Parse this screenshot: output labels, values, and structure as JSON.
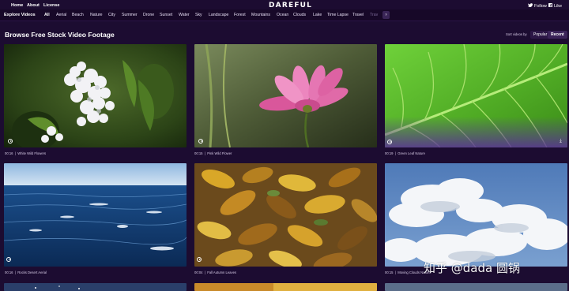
{
  "nav": {
    "links": [
      "Home",
      "About",
      "License"
    ],
    "logo": "DAREFUL",
    "follow_label": "Follow",
    "like_label": "Like",
    "follow_icon": "twitter-bird-icon",
    "like_icon": "facebook-icon"
  },
  "category_bar": {
    "explore_label": "Explore Videos",
    "categories": [
      "All",
      "Aerial",
      "Beach",
      "Nature",
      "City",
      "Summer",
      "Drone",
      "Sunset",
      "Water",
      "Sky",
      "Landscape",
      "Forest",
      "Mountains",
      "Ocean",
      "Clouds",
      "Lake",
      "Time Lapse",
      "Travel",
      "Trav"
    ],
    "active_category": "All",
    "next_icon": "chevron-right-icon"
  },
  "main": {
    "title": "Browse Free Stock Video Footage",
    "sort_label": "Sort videos by",
    "sort_options": [
      "Popular",
      "Recent"
    ],
    "selected_sort": "Recent"
  },
  "videos": [
    {
      "duration": "00:16",
      "title": "White Wild Flowers"
    },
    {
      "duration": "00:15",
      "title": "Pink Wild Flower"
    },
    {
      "duration": "00:19",
      "title": "Green Leaf Nature"
    },
    {
      "duration": "00:16",
      "title": "Rocks Desert Aerial"
    },
    {
      "duration": "00:04",
      "title": "Fall Autumn Leaves"
    },
    {
      "duration": "00:15",
      "title": "Moving Clouds Nature"
    }
  ],
  "watermark": "知乎 @dada 圆锅",
  "colors": {
    "background": "#1c0c31",
    "category_bar": "#170828",
    "accent_purple": "#5a2f99"
  }
}
